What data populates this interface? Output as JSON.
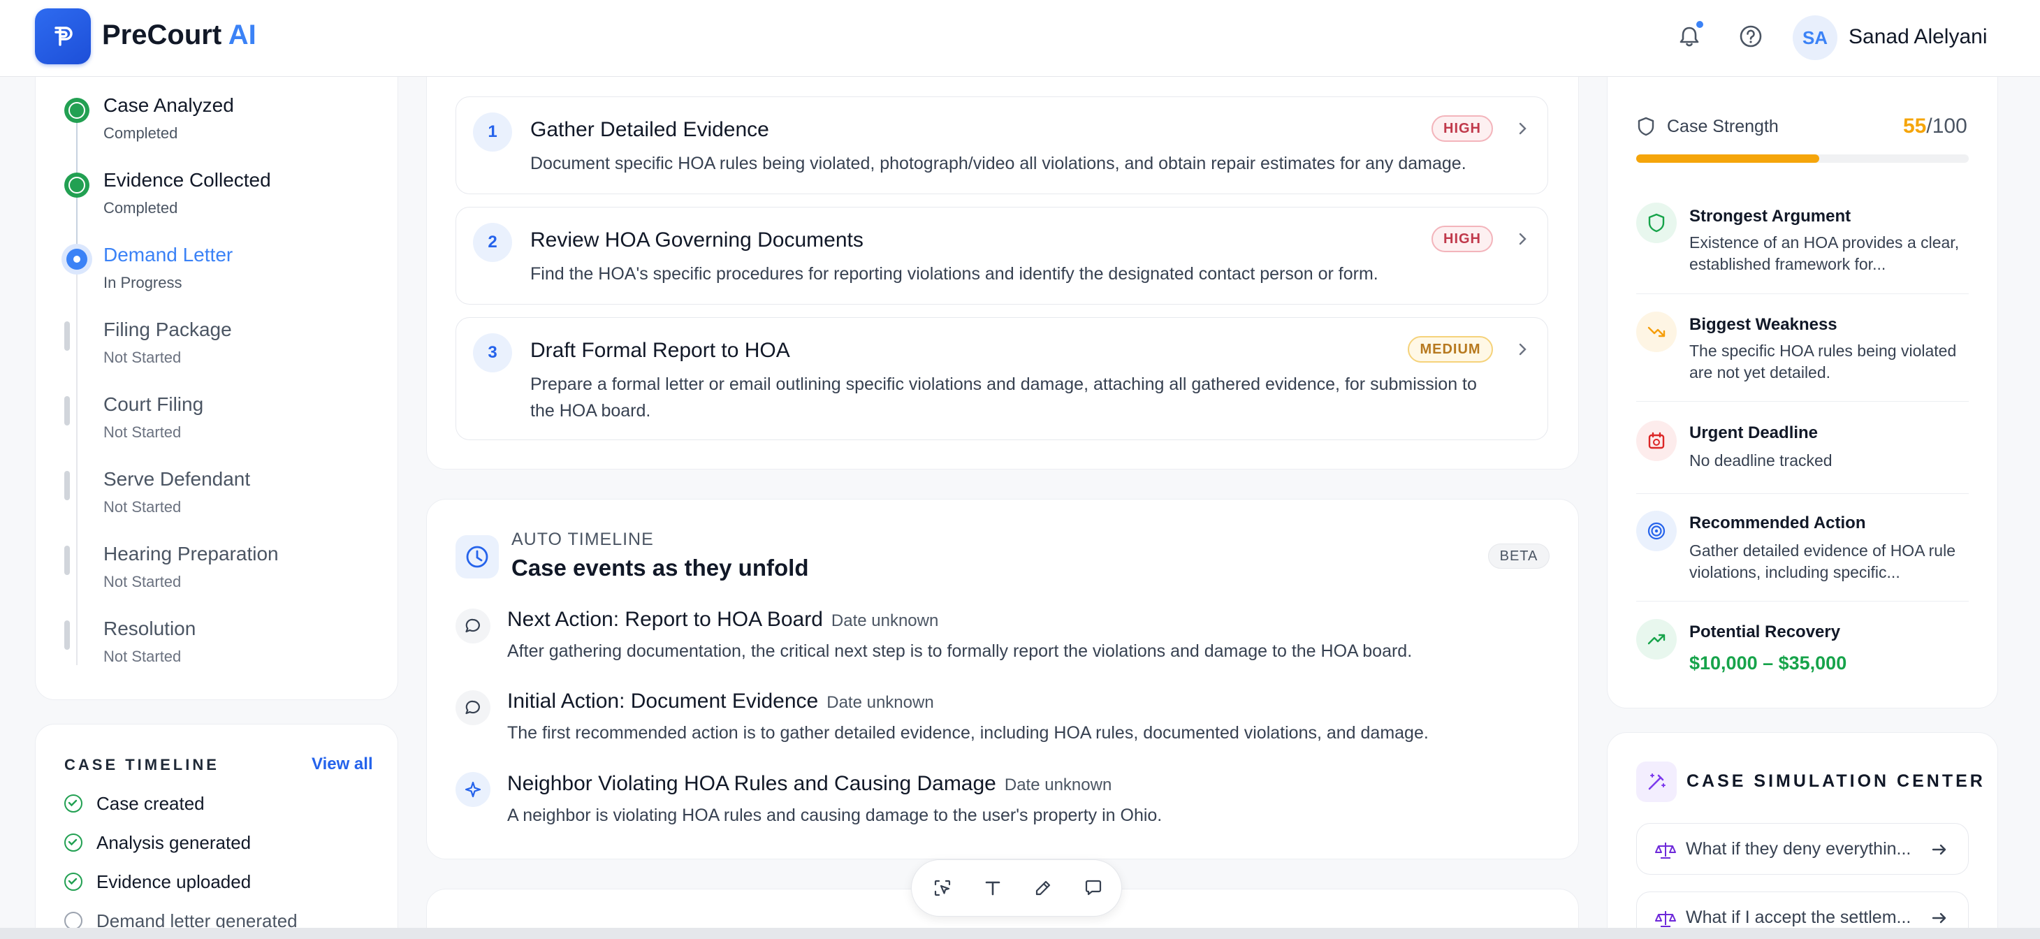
{
  "app": {
    "brand_main": "PreCourt",
    "brand_ai": "AI"
  },
  "header": {
    "user_initials": "SA",
    "user_name": "Sanad Alelyani",
    "notification_color": "#3b82f6"
  },
  "progress": {
    "steps": [
      {
        "title": "Case Analyzed",
        "status": "Completed"
      },
      {
        "title": "Evidence Collected",
        "status": "Completed"
      },
      {
        "title": "Demand Letter",
        "status": "In Progress"
      },
      {
        "title": "Filing Package",
        "status": "Not Started"
      },
      {
        "title": "Court Filing",
        "status": "Not Started"
      },
      {
        "title": "Serve Defendant",
        "status": "Not Started"
      },
      {
        "title": "Hearing Preparation",
        "status": "Not Started"
      },
      {
        "title": "Resolution",
        "status": "Not Started"
      }
    ]
  },
  "case_timeline": {
    "title": "CASE TIMELINE",
    "view_all": "View all",
    "items": [
      {
        "label": "Case created",
        "done": true
      },
      {
        "label": "Analysis generated",
        "done": true
      },
      {
        "label": "Evidence uploaded",
        "done": true
      },
      {
        "label": "Demand letter generated",
        "done": false
      }
    ]
  },
  "actions": [
    {
      "number": "1",
      "title": "Gather Detailed Evidence",
      "priority": "HIGH",
      "description": "Document specific HOA rules being violated, photograph/video all violations, and obtain repair estimates for any damage."
    },
    {
      "number": "2",
      "title": "Review HOA Governing Documents",
      "priority": "HIGH",
      "description": "Find the HOA's specific procedures for reporting violations and identify the designated contact person or form."
    },
    {
      "number": "3",
      "title": "Draft Formal Report to HOA",
      "priority": "MEDIUM",
      "description": "Prepare a formal letter or email outlining specific violations and damage, attaching all gathered evidence, for submission to the HOA board."
    }
  ],
  "auto_timeline": {
    "eyebrow": "AUTO TIMELINE",
    "title": "Case events as they unfold",
    "badge": "BETA",
    "events": [
      {
        "title": "Next Action: Report to HOA Board",
        "date": "Date unknown",
        "description": "After gathering documentation, the critical next step is to formally report the violations and damage to the HOA board.",
        "icon": "chat-bubble-icon"
      },
      {
        "title": "Initial Action: Document Evidence",
        "date": "Date unknown",
        "description": "The first recommended action is to gather detailed evidence, including HOA rules, documented violations, and damage.",
        "icon": "chat-bubble-icon"
      },
      {
        "title": "Neighbor Violating HOA Rules and Causing Damage",
        "date": "Date unknown",
        "description": "A neighbor is violating HOA rules and causing damage to the user's property in Ohio.",
        "icon": "sparkle-icon"
      }
    ]
  },
  "case_strength": {
    "label": "Case Strength",
    "score": "55",
    "max": "/100",
    "fraction": 0.55,
    "color": "#f5a50b"
  },
  "insights": [
    {
      "title": "Strongest Argument",
      "description": "Existence of an HOA provides a clear, established framework for...",
      "icon": "shield-icon",
      "color": "#16a34a"
    },
    {
      "title": "Biggest Weakness",
      "description": "The specific HOA rules being violated are not yet detailed.",
      "icon": "trend-down-icon",
      "color": "#f59e0b"
    },
    {
      "title": "Urgent Deadline",
      "description": "No deadline tracked",
      "icon": "calendar-alarm-icon",
      "color": "#dc2626"
    },
    {
      "title": "Recommended Action",
      "description": "Gather detailed evidence of HOA rule violations, including specific...",
      "icon": "target-icon",
      "color": "#2563eb"
    },
    {
      "title": "Potential Recovery",
      "value": "$10,000 – $35,000",
      "icon": "trend-up-icon",
      "color": "#16a34a"
    }
  ],
  "simulation": {
    "title": "CASE SIMULATION CENTER",
    "questions": [
      "What if they deny everythin...",
      "What if I accept the settlem..."
    ]
  }
}
